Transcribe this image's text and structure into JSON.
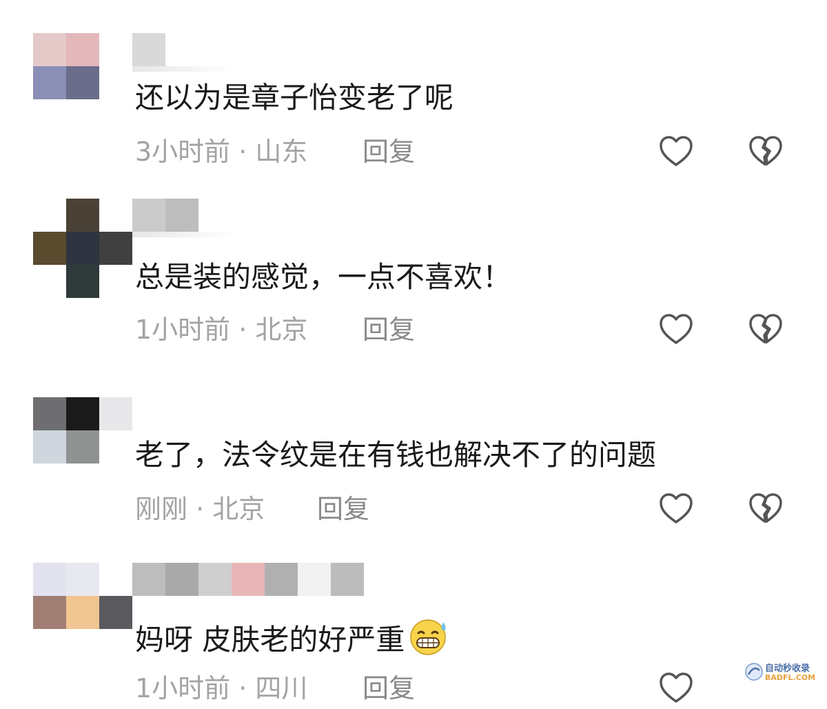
{
  "comments": [
    {
      "text": "还以为是章子怡变老了呢",
      "meta": "3小时前 · 山东",
      "reply_label": "回复",
      "avatar_pixels": [
        "#e5c9c9",
        "#e3b8bb",
        "#8c8fb5",
        "#6b6d8a"
      ],
      "username_pixels": [
        "#d9d9d9"
      ]
    },
    {
      "text": "总是装的感觉，一点不喜欢！",
      "meta": "1小时前 · 北京",
      "reply_label": "回复",
      "avatar_pixels": [
        "#ffffff",
        "#4a4236",
        "#5a4a2e",
        "#303440",
        "#404040",
        "#2f3a3a"
      ],
      "username_pixels": [
        "#cbcbcb",
        "#bdbdbd"
      ]
    },
    {
      "text": "老了，法令纹是在有钱也解决不了的问题",
      "meta": "刚刚 · 北京",
      "reply_label": "回复",
      "avatar_pixels": [
        "#6e6e70",
        "#1a1a1a",
        "#e8e8ea",
        "#cfd6dd",
        "#8e9392"
      ],
      "username_pixels": []
    },
    {
      "text": "妈呀 皮肤老的好严重",
      "emoji": "grinning-face-with-sweat",
      "meta": "1小时前 · 四川",
      "reply_label": "回复",
      "avatar_pixels": [
        "#e3e3ef",
        "#e8e8f0",
        "#a07e74",
        "#f1c591",
        "#5a5a5e"
      ],
      "username_pixels": [
        "#bdbdbd",
        "#a9a9a9",
        "#cfcfcf",
        "#e8b6b6",
        "#b0b0b0",
        "#f2f2f2",
        "#bcbcbc"
      ]
    }
  ],
  "icons": {
    "like": "heart-outline-icon",
    "dislike": "broken-heart-outline-icon"
  },
  "watermark": {
    "top": "自动秒收录",
    "bottom": "BADFL.COM"
  }
}
